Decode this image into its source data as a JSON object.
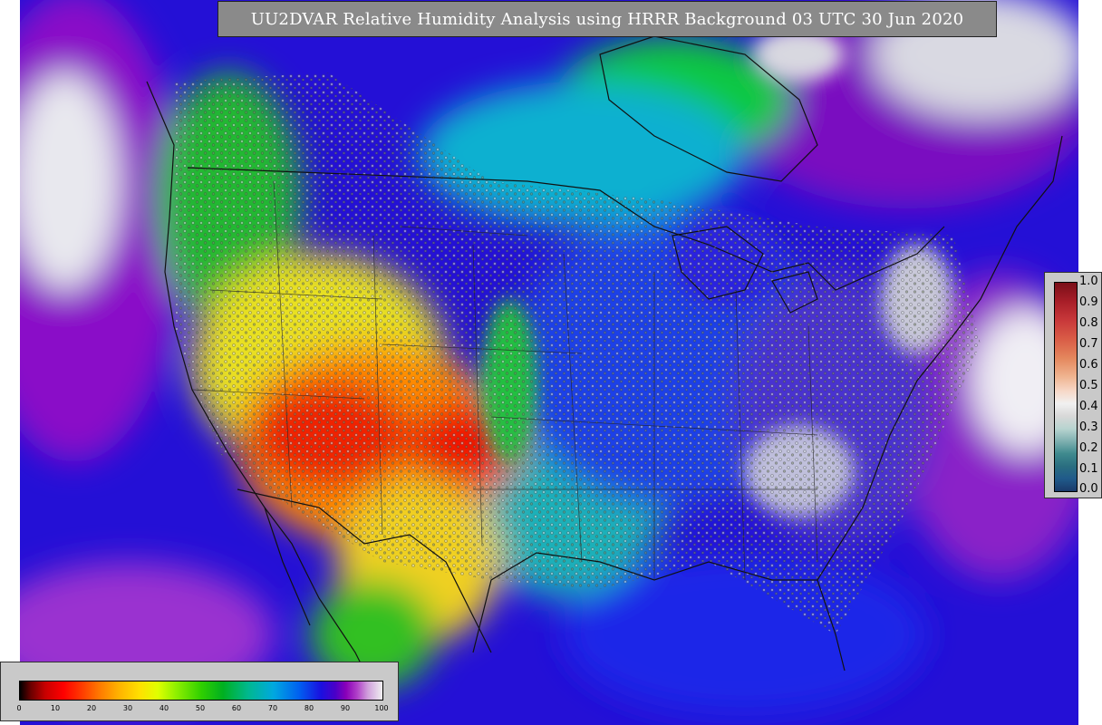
{
  "title": "UU2DVAR Relative Humidity Analysis using HRRR Background 03 UTC 30 Jun 2020",
  "obs_legend": {
    "ticks": [
      "1.0",
      "0.9",
      "0.8",
      "0.7",
      "0.6",
      "0.5",
      "0.4",
      "0.3",
      "0.2",
      "0.1",
      "0.0"
    ]
  },
  "rh_legend": {
    "ticks": [
      "0",
      "10",
      "20",
      "30",
      "40",
      "50",
      "60",
      "70",
      "80",
      "90",
      "100"
    ]
  }
}
